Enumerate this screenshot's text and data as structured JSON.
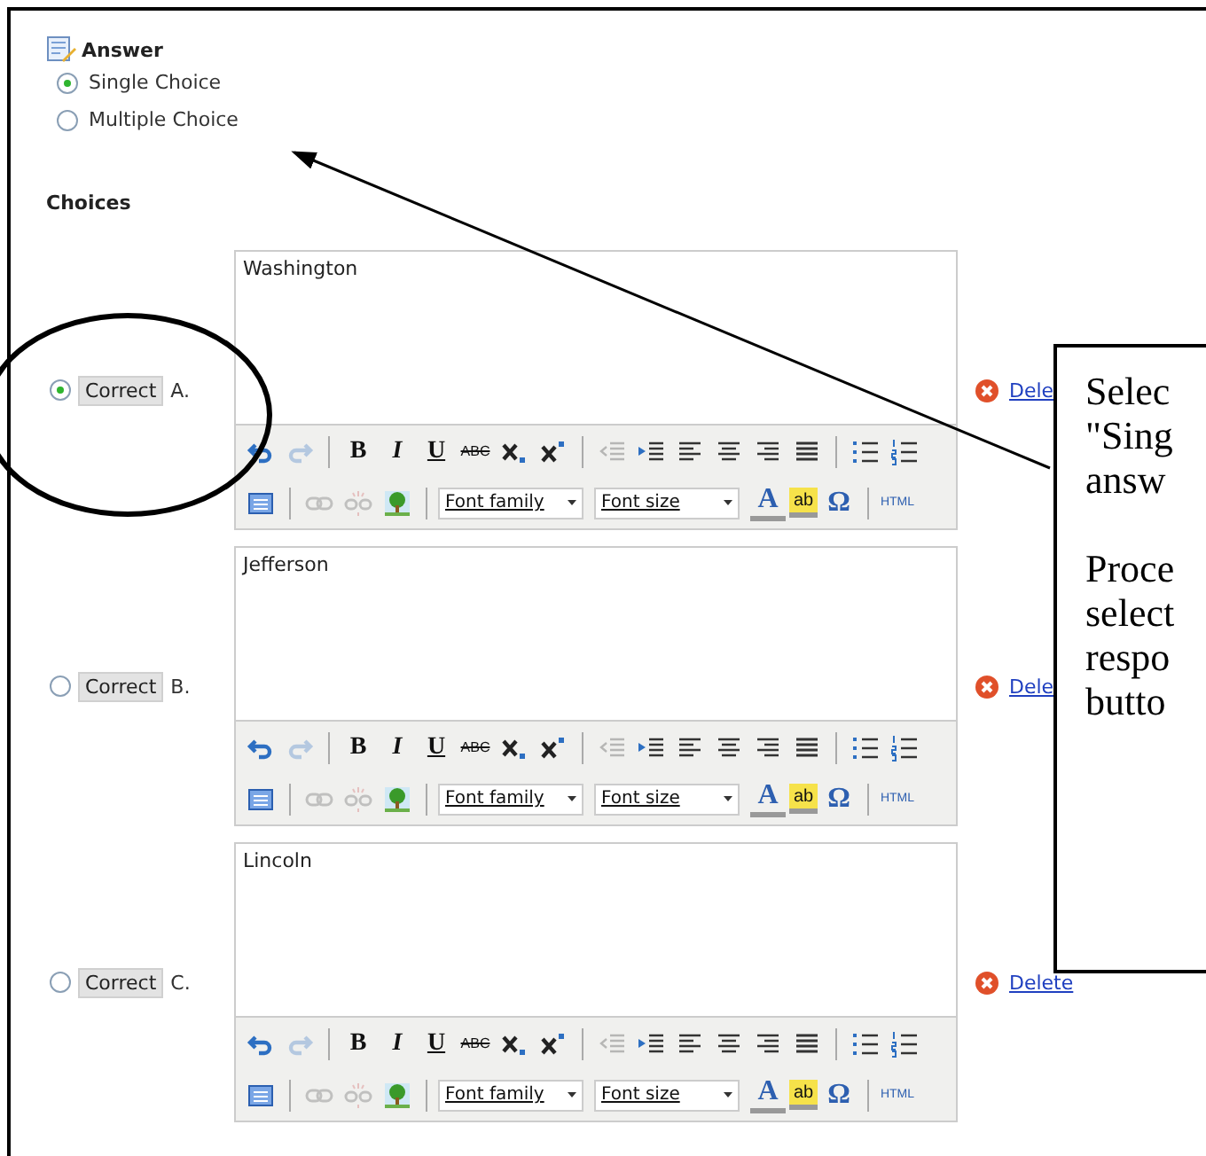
{
  "answer": {
    "title": "Answer",
    "options": [
      {
        "label": "Single Choice",
        "selected": true
      },
      {
        "label": "Multiple Choice",
        "selected": false
      }
    ]
  },
  "choices_title": "Choices",
  "choices": [
    {
      "correct": true,
      "correct_label": "Correct",
      "letter": "A.",
      "text": "Washington",
      "delete_label": "Dele",
      "toolbar": [
        [
          {
            "kind": "undo",
            "disabled": false
          },
          {
            "kind": "redo",
            "disabled": true
          },
          {
            "kind": "sep"
          },
          {
            "kind": "bold",
            "label": "B",
            "disabled": false
          },
          {
            "kind": "italic",
            "label": "I",
            "disabled": false
          },
          {
            "kind": "underline",
            "label": "U",
            "disabled": false
          },
          {
            "kind": "strike",
            "label": "ABC",
            "disabled": false
          },
          {
            "kind": "subscript",
            "disabled": false
          },
          {
            "kind": "superscript",
            "disabled": false
          },
          {
            "kind": "sep"
          },
          {
            "kind": "outdent",
            "disabled": true
          },
          {
            "kind": "indent",
            "disabled": false
          },
          {
            "kind": "align-left",
            "disabled": false
          },
          {
            "kind": "align-center",
            "disabled": false
          },
          {
            "kind": "align-right",
            "disabled": false
          },
          {
            "kind": "align-justify",
            "disabled": false
          },
          {
            "kind": "sep"
          },
          {
            "kind": "bullets",
            "disabled": false
          },
          {
            "kind": "numbering",
            "disabled": false
          }
        ],
        [
          {
            "kind": "table",
            "disabled": false
          },
          {
            "kind": "sep"
          },
          {
            "kind": "link",
            "disabled": true
          },
          {
            "kind": "unlink",
            "disabled": true
          },
          {
            "kind": "image",
            "disabled": false
          },
          {
            "kind": "sep"
          },
          {
            "kind": "dropdown",
            "label": "Font family",
            "disabled": false
          },
          {
            "kind": "dropdown",
            "label": "Font size",
            "disabled": false
          },
          {
            "kind": "text-color",
            "label": "A",
            "disabled": false
          },
          {
            "kind": "highlight",
            "label": "ab",
            "disabled": false
          },
          {
            "kind": "symbol",
            "label": "Ω",
            "disabled": false
          },
          {
            "kind": "sep"
          },
          {
            "kind": "html",
            "label": "HTML",
            "disabled": false
          }
        ]
      ]
    },
    {
      "correct": false,
      "correct_label": "Correct",
      "letter": "B.",
      "text": "Jefferson",
      "delete_label": "Dele",
      "toolbar": [
        [
          {
            "kind": "undo",
            "disabled": false
          },
          {
            "kind": "redo",
            "disabled": true
          },
          {
            "kind": "sep"
          },
          {
            "kind": "bold",
            "label": "B",
            "disabled": false
          },
          {
            "kind": "italic",
            "label": "I",
            "disabled": false
          },
          {
            "kind": "underline",
            "label": "U",
            "disabled": false
          },
          {
            "kind": "strike",
            "label": "ABC",
            "disabled": false
          },
          {
            "kind": "subscript",
            "disabled": false
          },
          {
            "kind": "superscript",
            "disabled": false
          },
          {
            "kind": "sep"
          },
          {
            "kind": "outdent",
            "disabled": true
          },
          {
            "kind": "indent",
            "disabled": false
          },
          {
            "kind": "align-left",
            "disabled": false
          },
          {
            "kind": "align-center",
            "disabled": false
          },
          {
            "kind": "align-right",
            "disabled": false
          },
          {
            "kind": "align-justify",
            "disabled": false
          },
          {
            "kind": "sep"
          },
          {
            "kind": "bullets",
            "disabled": false
          },
          {
            "kind": "numbering",
            "disabled": false
          }
        ],
        [
          {
            "kind": "table",
            "disabled": false
          },
          {
            "kind": "sep"
          },
          {
            "kind": "link",
            "disabled": true
          },
          {
            "kind": "unlink",
            "disabled": true
          },
          {
            "kind": "image",
            "disabled": false
          },
          {
            "kind": "sep"
          },
          {
            "kind": "dropdown",
            "label": "Font family",
            "disabled": false
          },
          {
            "kind": "dropdown",
            "label": "Font size",
            "disabled": false
          },
          {
            "kind": "text-color",
            "label": "A",
            "disabled": false
          },
          {
            "kind": "highlight",
            "label": "ab",
            "disabled": false
          },
          {
            "kind": "symbol",
            "label": "Ω",
            "disabled": false
          },
          {
            "kind": "sep"
          },
          {
            "kind": "html",
            "label": "HTML",
            "disabled": false
          }
        ]
      ]
    },
    {
      "correct": false,
      "correct_label": "Correct",
      "letter": "C.",
      "text": "Lincoln",
      "delete_label": "Delete",
      "toolbar": [
        [
          {
            "kind": "undo",
            "disabled": false
          },
          {
            "kind": "redo",
            "disabled": true
          },
          {
            "kind": "sep"
          },
          {
            "kind": "bold",
            "label": "B",
            "disabled": false
          },
          {
            "kind": "italic",
            "label": "I",
            "disabled": false
          },
          {
            "kind": "underline",
            "label": "U",
            "disabled": false
          },
          {
            "kind": "strike",
            "label": "ABC",
            "disabled": false
          },
          {
            "kind": "subscript",
            "disabled": false
          },
          {
            "kind": "superscript",
            "disabled": false
          },
          {
            "kind": "sep"
          },
          {
            "kind": "outdent",
            "disabled": true
          },
          {
            "kind": "indent",
            "disabled": false
          },
          {
            "kind": "align-left",
            "disabled": false
          },
          {
            "kind": "align-center",
            "disabled": false
          },
          {
            "kind": "align-right",
            "disabled": false
          },
          {
            "kind": "align-justify",
            "disabled": false
          },
          {
            "kind": "sep"
          },
          {
            "kind": "bullets",
            "disabled": false
          },
          {
            "kind": "numbering",
            "disabled": false
          }
        ],
        [
          {
            "kind": "table",
            "disabled": false
          },
          {
            "kind": "sep"
          },
          {
            "kind": "link",
            "disabled": true
          },
          {
            "kind": "unlink",
            "disabled": true
          },
          {
            "kind": "image",
            "disabled": false
          },
          {
            "kind": "sep"
          },
          {
            "kind": "dropdown",
            "label": "Font family",
            "disabled": false
          },
          {
            "kind": "dropdown",
            "label": "Font size",
            "disabled": false
          },
          {
            "kind": "text-color",
            "label": "A",
            "disabled": false
          },
          {
            "kind": "highlight",
            "label": "ab",
            "disabled": false
          },
          {
            "kind": "symbol",
            "label": "Ω",
            "disabled": false
          },
          {
            "kind": "sep"
          },
          {
            "kind": "html",
            "label": "HTML",
            "disabled": false
          }
        ]
      ]
    }
  ],
  "callout": {
    "paragraphs": [
      [
        "Selec",
        "\"Sing",
        "answ"
      ],
      [
        "Proce",
        "select",
        "respo",
        "butto"
      ]
    ]
  }
}
